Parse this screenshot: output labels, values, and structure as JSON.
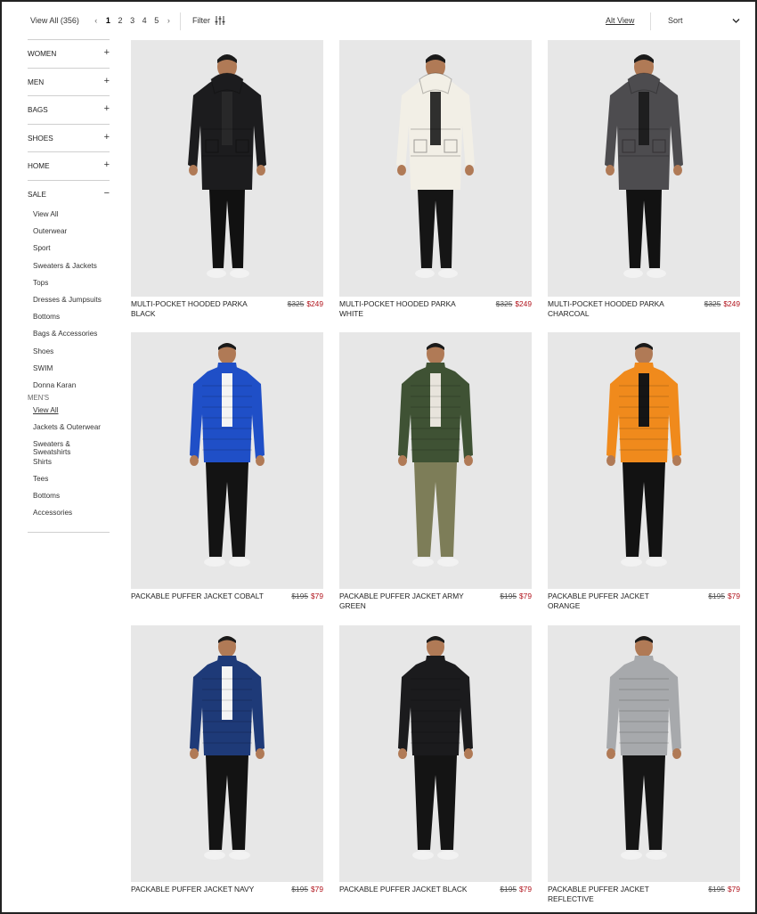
{
  "topbar": {
    "view_all": "View All (356)",
    "pages": [
      "1",
      "2",
      "3",
      "4",
      "5"
    ],
    "prev": "‹",
    "next": "›",
    "filter": "Filter",
    "alt_view": "Alt View",
    "sort": "Sort"
  },
  "sidebar": {
    "categories": [
      {
        "label": "WOMEN",
        "toggle": "+"
      },
      {
        "label": "MEN",
        "toggle": "+"
      },
      {
        "label": "BAGS",
        "toggle": "+"
      },
      {
        "label": "SHOES",
        "toggle": "+"
      },
      {
        "label": "HOME",
        "toggle": "+"
      },
      {
        "label": "SALE",
        "toggle": "−"
      }
    ],
    "sale_items": [
      "View All",
      "Outerwear",
      "Sport",
      "Sweaters & Jackets",
      "Tops",
      "Dresses & Jumpsuits",
      "Bottoms",
      "Bags & Accessories",
      "Shoes",
      "SWIM",
      "Donna Karan"
    ],
    "mens_heading": "MEN'S",
    "mens_items": [
      "View All",
      "Jackets & Outerwear",
      "Sweaters & Sweatshirts",
      "Shirts",
      "Tees",
      "Bottoms",
      "Accessories"
    ]
  },
  "products": [
    {
      "name": "MULTI-POCKET HOODED PARKA BLACK",
      "orig": "$325",
      "sale": "$249",
      "jacket": "#1c1c1e",
      "pants": "#111111",
      "style": "parka",
      "shirt": "#2a2a2a"
    },
    {
      "name": "MULTI-POCKET HOODED PARKA WHITE",
      "orig": "$325",
      "sale": "$249",
      "jacket": "#f2efe6",
      "pants": "#151515",
      "style": "parka",
      "shirt": "#1a1a1a"
    },
    {
      "name": "MULTI-POCKET HOODED PARKA CHARCOAL",
      "orig": "$325",
      "sale": "$249",
      "jacket": "#4d4c4f",
      "pants": "#121212",
      "style": "parka",
      "shirt": "#1a1a1a"
    },
    {
      "name": "PACKABLE PUFFER JACKET COBALT",
      "orig": "$195",
      "sale": "$79",
      "jacket": "#1f4fc7",
      "pants": "#131313",
      "style": "puffer",
      "shirt": "#f4f4f4"
    },
    {
      "name": "PACKABLE PUFFER JACKET ARMY GREEN",
      "orig": "$195",
      "sale": "$79",
      "jacket": "#3f5234",
      "pants": "#7d7d58",
      "style": "puffer",
      "shirt": "#e8e4dc"
    },
    {
      "name": "PACKABLE PUFFER JACKET ORANGE",
      "orig": "$195",
      "sale": "$79",
      "jacket": "#f08a1c",
      "pants": "#121212",
      "style": "puffer",
      "shirt": "#151515"
    },
    {
      "name": "PACKABLE PUFFER JACKET NAVY",
      "orig": "$195",
      "sale": "$79",
      "jacket": "#1e3a78",
      "pants": "#131313",
      "style": "puffer",
      "shirt": "#f4f4f4"
    },
    {
      "name": "PACKABLE PUFFER JACKET BLACK",
      "orig": "$195",
      "sale": "$79",
      "jacket": "#1b1b1d",
      "pants": "#141414",
      "style": "puffer",
      "shirt": "#1b1b1d"
    },
    {
      "name": "PACKABLE PUFFER JACKET REFLECTIVE",
      "orig": "$195",
      "sale": "$79",
      "jacket": "#a7a9ac",
      "pants": "#151515",
      "style": "puffer",
      "shirt": "#a7a9ac"
    }
  ]
}
